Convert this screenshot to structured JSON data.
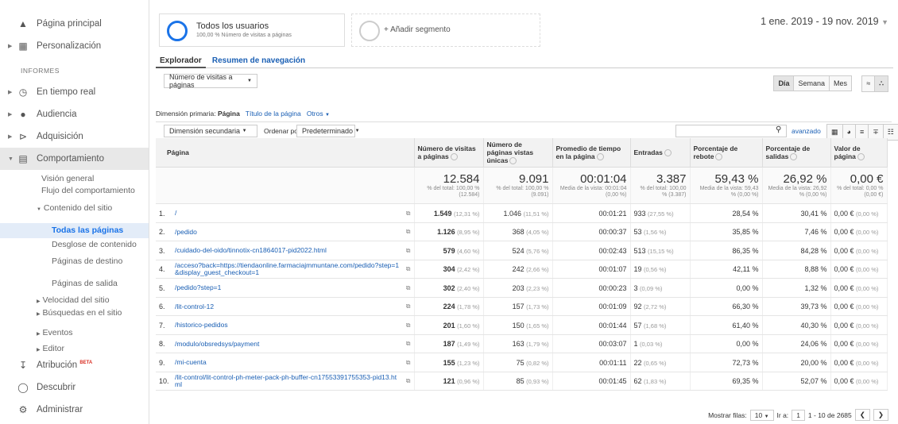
{
  "sidebar": {
    "home": "Página principal",
    "custom": "Personalización",
    "section": "INFORMES",
    "realtime": "En tiempo real",
    "audience": "Audiencia",
    "acquisition": "Adquisición",
    "behavior": "Comportamiento",
    "overview": "Visión general",
    "flow": "Flujo del comportamiento",
    "content": "Contenido del sitio",
    "allpages": "Todas las páginas",
    "breakdown": "Desglose de contenido",
    "landing": "Páginas de destino",
    "exit": "Páginas de salida",
    "speed": "Velocidad del sitio",
    "search": "Búsquedas en el sitio",
    "events": "Eventos",
    "editor": "Editor",
    "attribution": "Atribución",
    "beta": "BETA",
    "discover": "Descubrir",
    "admin": "Administrar"
  },
  "segments": {
    "all_title": "Todos los usuarios",
    "all_sub": "100,00 % Número de visitas a páginas",
    "add": "+ Añadir segmento"
  },
  "date_range": "1 ene. 2019 - 19 nov. 2019",
  "tabs": {
    "explorer": "Explorador",
    "nav": "Resumen de navegación"
  },
  "metric_select": "Número de visitas a páginas",
  "view_buttons": [
    "Día",
    "Semana",
    "Mes"
  ],
  "dimension": {
    "label": "Dimensión primaria:",
    "current": "Página",
    "title": "Título de la página",
    "others": "Otros"
  },
  "controls": {
    "secondary": "Dimensión secundaria",
    "sortby": "Ordenar por tipo:",
    "default": "Predeterminado",
    "advanced": "avanzado"
  },
  "columns": [
    "Página",
    "Número de visitas a páginas",
    "Número de páginas vistas únicas",
    "Promedio de tiempo en la página",
    "Entradas",
    "Porcentaje de rebote",
    "Porcentaje de salidas",
    "Valor de página"
  ],
  "totals": [
    {
      "v": "12.584",
      "s": "% del total: 100,00 % (12.584)"
    },
    {
      "v": "9.091",
      "s": "% del total: 100,00 % (9.091)"
    },
    {
      "v": "00:01:04",
      "s": "Media de la vista: 00:01:04 (0,00 %)"
    },
    {
      "v": "3.387",
      "s": "% del total: 100,00 % (3.387)"
    },
    {
      "v": "59,43 %",
      "s": "Media de la vista: 59,43 % (0,00 %)"
    },
    {
      "v": "26,92 %",
      "s": "Media de la vista: 26,92 % (0,00 %)"
    },
    {
      "v": "0,00 €",
      "s": "% del total: 0,00 % (0,00 €)"
    }
  ],
  "rows": [
    {
      "n": "1.",
      "p": "/",
      "pv": "1.549",
      "pvp": "(12,31 %)",
      "u": "1.046",
      "up": "(11,51 %)",
      "t": "00:01:21",
      "e": "933",
      "ep": "(27,55 %)",
      "b": "28,54 %",
      "x": "30,41 %",
      "val": "0,00 €",
      "vp": "(0,00 %)"
    },
    {
      "n": "2.",
      "p": "/pedido",
      "pv": "1.126",
      "pvp": "(8,95 %)",
      "u": "368",
      "up": "(4,05 %)",
      "t": "00:00:37",
      "e": "53",
      "ep": "(1,56 %)",
      "b": "35,85 %",
      "x": "7,46 %",
      "val": "0,00 €",
      "vp": "(0,00 %)"
    },
    {
      "n": "3.",
      "p": "/cuidado-del-oido/tinnotix-cn1864017-pid2022.html",
      "pv": "579",
      "pvp": "(4,60 %)",
      "u": "524",
      "up": "(5,76 %)",
      "t": "00:02:43",
      "e": "513",
      "ep": "(15,15 %)",
      "b": "86,35 %",
      "x": "84,28 %",
      "val": "0,00 €",
      "vp": "(0,00 %)"
    },
    {
      "n": "4.",
      "p": "/acceso?back=https://tiendaonline.farmaciajmmuntane.com/pedido?step=1&display_guest_checkout=1",
      "pv": "304",
      "pvp": "(2,42 %)",
      "u": "242",
      "up": "(2,66 %)",
      "t": "00:01:07",
      "e": "19",
      "ep": "(0,56 %)",
      "b": "42,11 %",
      "x": "8,88 %",
      "val": "0,00 €",
      "vp": "(0,00 %)"
    },
    {
      "n": "5.",
      "p": "/pedido?step=1",
      "pv": "302",
      "pvp": "(2,40 %)",
      "u": "203",
      "up": "(2,23 %)",
      "t": "00:00:23",
      "e": "3",
      "ep": "(0,09 %)",
      "b": "0,00 %",
      "x": "1,32 %",
      "val": "0,00 €",
      "vp": "(0,00 %)"
    },
    {
      "n": "6.",
      "p": "/lit-control-12",
      "pv": "224",
      "pvp": "(1,78 %)",
      "u": "157",
      "up": "(1,73 %)",
      "t": "00:01:09",
      "e": "92",
      "ep": "(2,72 %)",
      "b": "66,30 %",
      "x": "39,73 %",
      "val": "0,00 €",
      "vp": "(0,00 %)"
    },
    {
      "n": "7.",
      "p": "/historico-pedidos",
      "pv": "201",
      "pvp": "(1,60 %)",
      "u": "150",
      "up": "(1,65 %)",
      "t": "00:01:44",
      "e": "57",
      "ep": "(1,68 %)",
      "b": "61,40 %",
      "x": "40,30 %",
      "val": "0,00 €",
      "vp": "(0,00 %)"
    },
    {
      "n": "8.",
      "p": "/modulo/obsredsys/payment",
      "pv": "187",
      "pvp": "(1,49 %)",
      "u": "163",
      "up": "(1,79 %)",
      "t": "00:03:07",
      "e": "1",
      "ep": "(0,03 %)",
      "b": "0,00 %",
      "x": "24,06 %",
      "val": "0,00 €",
      "vp": "(0,00 %)"
    },
    {
      "n": "9.",
      "p": "/mi-cuenta",
      "pv": "155",
      "pvp": "(1,23 %)",
      "u": "75",
      "up": "(0,82 %)",
      "t": "00:01:11",
      "e": "22",
      "ep": "(0,65 %)",
      "b": "72,73 %",
      "x": "20,00 %",
      "val": "0,00 €",
      "vp": "(0,00 %)"
    },
    {
      "n": "10.",
      "p": "/lit-control/lit-control-ph-meter-pack-ph-buffer-cn17553391755353-pid13.html",
      "pv": "121",
      "pvp": "(0,96 %)",
      "u": "85",
      "up": "(0,93 %)",
      "t": "00:01:45",
      "e": "62",
      "ep": "(1,83 %)",
      "b": "69,35 %",
      "x": "52,07 %",
      "val": "0,00 €",
      "vp": "(0,00 %)"
    }
  ],
  "footer": {
    "show": "Mostrar filas:",
    "rows": "10",
    "goto": "Ir a:",
    "page": "1",
    "range": "1 - 10 de 2685"
  }
}
